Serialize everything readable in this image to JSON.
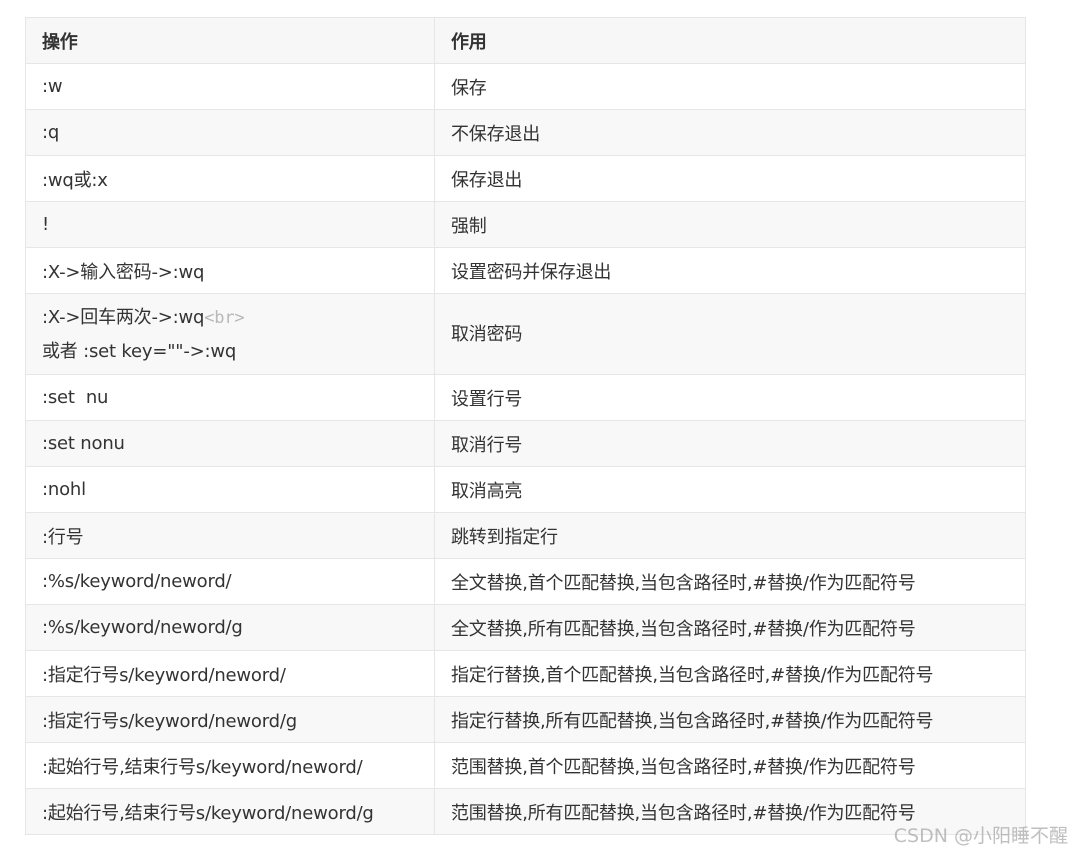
{
  "table": {
    "headers": [
      "操作",
      "作用"
    ],
    "rows": [
      {
        "op": ":w",
        "desc": "保存"
      },
      {
        "op": ":q",
        "desc": "不保存退出"
      },
      {
        "op": ":wq或:x",
        "desc": "保存退出"
      },
      {
        "op": "!",
        "desc": "强制"
      },
      {
        "op": ":X->输入密码->:wq",
        "desc": "设置密码并保存退出"
      },
      {
        "op": ":X->回车两次->:wq",
        "op_tag": "<br>",
        "op_line2": "或者 :set key=\"\"->:wq",
        "desc": "取消密码"
      },
      {
        "op": ":set  nu",
        "desc": "设置行号"
      },
      {
        "op": ":set nonu",
        "desc": "取消行号"
      },
      {
        "op": ":nohl",
        "desc": "取消高亮"
      },
      {
        "op": ":行号",
        "desc": "跳转到指定行"
      },
      {
        "op": ":%s/keyword/neword/",
        "desc": "全文替换,首个匹配替换,当包含路径时,#替换/作为匹配符号"
      },
      {
        "op": ":%s/keyword/neword/g",
        "desc": "全文替换,所有匹配替换,当包含路径时,#替换/作为匹配符号"
      },
      {
        "op": ":指定行号s/keyword/neword/",
        "desc": "指定行替换,首个匹配替换,当包含路径时,#替换/作为匹配符号"
      },
      {
        "op": ":指定行号s/keyword/neword/g",
        "desc": "指定行替换,所有匹配替换,当包含路径时,#替换/作为匹配符号"
      },
      {
        "op": ":起始行号,结束行号s/keyword/neword/",
        "desc": "范围替换,首个匹配替换,当包含路径时,#替换/作为匹配符号"
      },
      {
        "op": ":起始行号,结束行号s/keyword/neword/g",
        "desc": "范围替换,所有匹配替换,当包含路径时,#替换/作为匹配符号"
      }
    ]
  },
  "watermark": "CSDN @小阳睡不醒"
}
